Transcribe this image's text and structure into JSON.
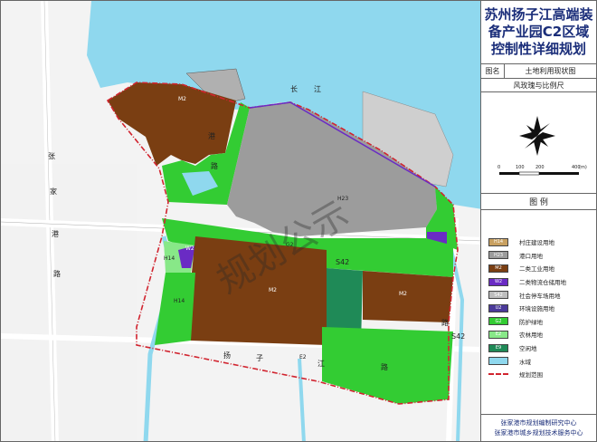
{
  "title": {
    "line1": "苏州扬子江高端装",
    "line2": "备产业园C2区域",
    "line3": "控制性详细规划"
  },
  "drawing": {
    "name_key": "图名",
    "name_value": "土地利用现状图"
  },
  "rose_label": "风玫瑰与比例尺",
  "scale_bar": {
    "ticks": [
      "0",
      "100",
      "200",
      "400"
    ],
    "unit": "(m)"
  },
  "legend": {
    "title": "图    例",
    "items": [
      {
        "code": "H14",
        "label": "村庄建设用地",
        "color": "#c8a060"
      },
      {
        "code": "H23",
        "label": "港口用地",
        "color": "#9c9c9c"
      },
      {
        "code": "M2",
        "label": "二类工业用地",
        "color": "#7a3e12"
      },
      {
        "code": "W2",
        "label": "二类物流仓储用地",
        "color": "#6a2bc4"
      },
      {
        "code": "S42",
        "label": "社会停车场用地",
        "color": "#bdbdbd"
      },
      {
        "code": "U2",
        "label": "环境设施用地",
        "color": "#4b3a9a"
      },
      {
        "code": "G2",
        "label": "防护绿地",
        "color": "#33cc33"
      },
      {
        "code": "E2",
        "label": "农林用地",
        "color": "#88e888"
      },
      {
        "code": "E9",
        "label": "空闲地",
        "color": "#1f8a57"
      },
      {
        "code": "",
        "label": "水域",
        "color": "#8fd8ee"
      },
      {
        "code": "",
        "label": "规划范围",
        "color": "#d1242f"
      }
    ]
  },
  "footer": {
    "line1": "张家港市规划编制研究中心",
    "line2": "张家港市城乡规划技术服务中心"
  },
  "map": {
    "watermark": "规划公示",
    "codes": {
      "m1": "M2",
      "m2": "M2",
      "m3": "M2",
      "h23": "H23",
      "h14a": "H14",
      "h14b": "H14",
      "e2a": "E2",
      "w2": "W2",
      "s42": "S42",
      "g2": "G2"
    },
    "roads": {
      "r1": "S42",
      "r2": "G2",
      "r3": "S42"
    },
    "road_chars": [
      "张",
      "家",
      "港",
      "路",
      "长",
      "江",
      "港",
      "路",
      "扬",
      "子",
      "江",
      "路",
      "路"
    ]
  }
}
